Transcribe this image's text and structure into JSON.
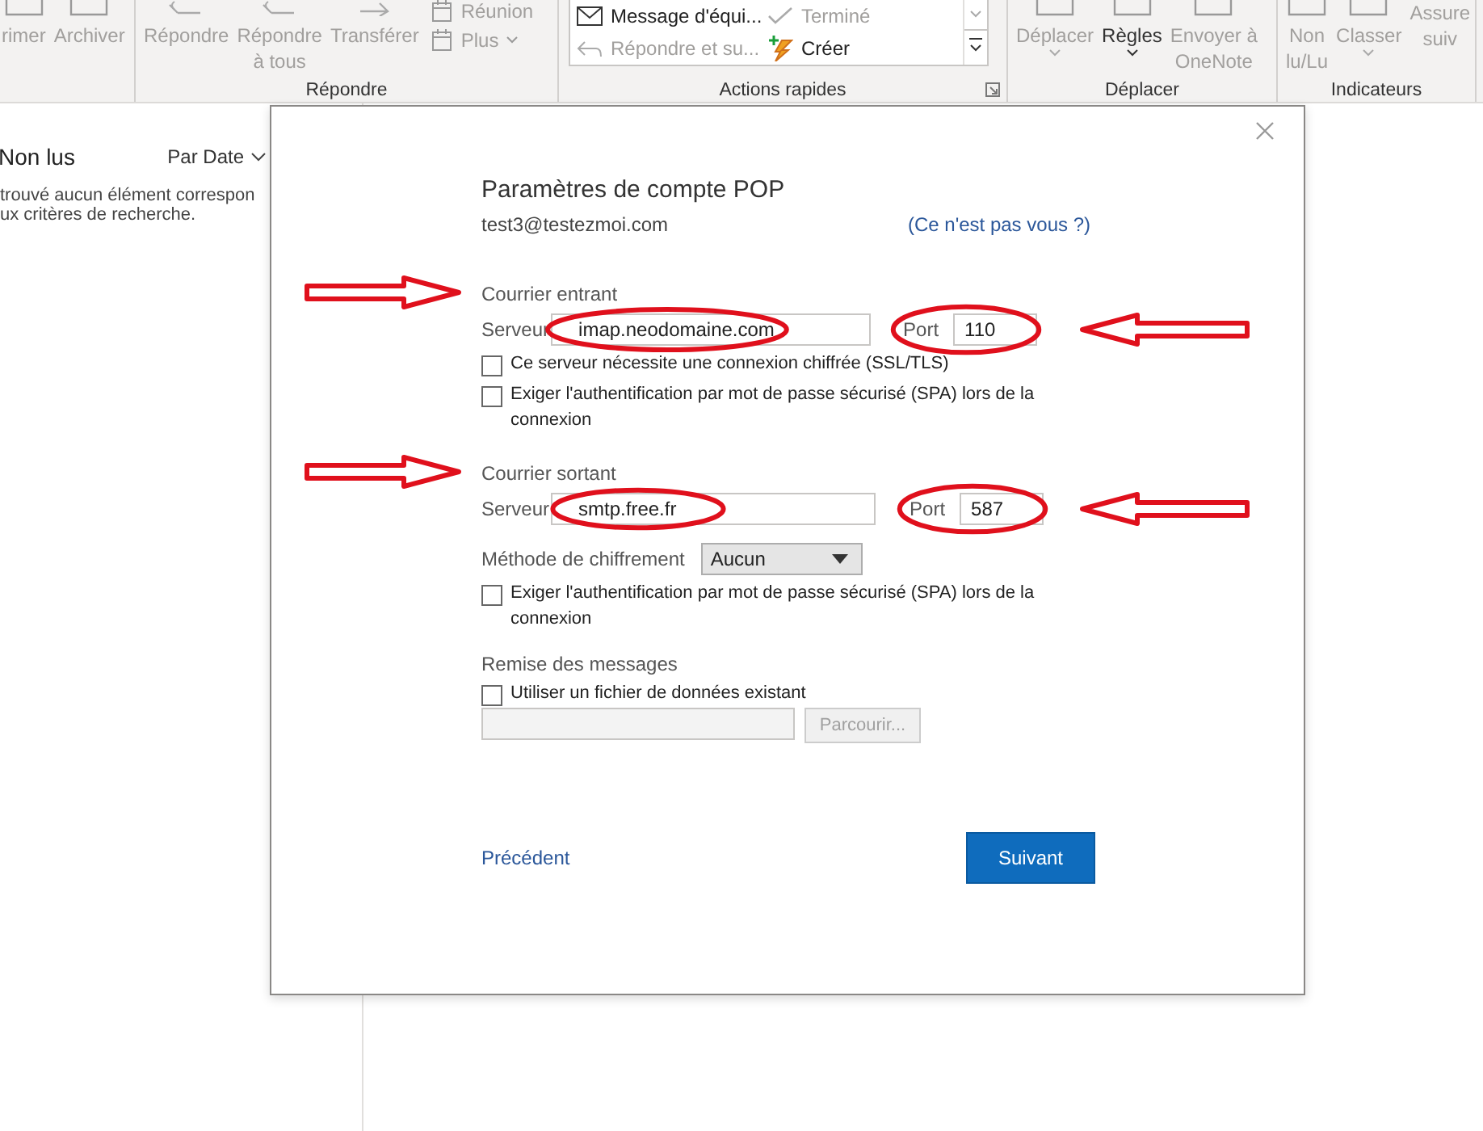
{
  "ribbon": {
    "groups": [
      {
        "commands": [
          {
            "label": "rimer",
            "kind": "trash",
            "disabled": true,
            "dropdown": false
          },
          {
            "label": "Archiver",
            "kind": "box",
            "disabled": true,
            "dropdown": false
          }
        ]
      },
      {
        "label": "Répondre",
        "commands": [
          {
            "label": "Répondre",
            "kind": "reply",
            "disabled": true,
            "dropdown": false
          },
          {
            "label": "Répondre\nà tous",
            "kind": "reply",
            "disabled": true,
            "dropdown": false
          },
          {
            "label": "Transférer",
            "kind": "forward",
            "disabled": true,
            "dropdown": false
          }
        ],
        "small_commands": [
          {
            "label": "Réunion",
            "kind": "calendar",
            "disabled": true,
            "dropdown": false
          },
          {
            "label": "Plus",
            "kind": "calendar",
            "disabled": true,
            "dropdown": true
          }
        ]
      },
      {
        "label": "Actions rapides",
        "quick_steps": [
          {
            "label": "Message d'équi...",
            "kind": "mail",
            "disabled": false
          },
          {
            "label": "Terminé",
            "kind": "check",
            "disabled": true
          },
          {
            "label": "Répondre et su...",
            "kind": "reply",
            "disabled": true
          },
          {
            "label": "Créer",
            "kind": "bolt",
            "disabled": false
          }
        ]
      },
      {
        "label": "Déplacer",
        "commands": [
          {
            "label": "Déplacer",
            "kind": "box",
            "disabled": true,
            "dropdown": true
          },
          {
            "label": "Règles",
            "kind": "box",
            "disabled": false,
            "dropdown": true
          },
          {
            "label": "Envoyer à\nOneNote",
            "kind": "box",
            "disabled": true,
            "dropdown": false
          }
        ]
      },
      {
        "label": "Indicateurs",
        "commands": [
          {
            "label": "Non\nlu/Lu",
            "kind": "box",
            "disabled": true,
            "dropdown": false
          },
          {
            "label": "Classer",
            "kind": "box",
            "disabled": true,
            "dropdown": true
          },
          {
            "label": "Assure\nsuiv",
            "kind": "none",
            "disabled": true,
            "dropdown": false
          }
        ]
      }
    ]
  },
  "message_list": {
    "filter": "Non lus",
    "sort": "Par Date",
    "empty_message": [
      "trouvé aucun élément correspon",
      "ux critères de recherche."
    ]
  },
  "dialog": {
    "title": "Paramètres de compte POP",
    "email": "test3@testezmoi.com",
    "not_you_link": "(Ce n'est pas vous ?)",
    "incoming": {
      "heading": "Courrier entrant",
      "marked": true,
      "server_label": "Serveur",
      "server": "imap.neodomaine.com",
      "server_highlighted": true,
      "port_label": "Port",
      "port": "110",
      "port_highlighted": true,
      "options": [
        {
          "label": "Ce serveur nécessite une connexion chiffrée (SSL/TLS)",
          "checked": false
        },
        {
          "label": "Exiger l'authentification par mot de passe sécurisé (SPA) lors de la connexion",
          "checked": false
        }
      ]
    },
    "outgoing": {
      "heading": "Courrier sortant",
      "marked": true,
      "server_label": "Serveur",
      "server": "smtp.free.fr",
      "server_highlighted": true,
      "port_label": "Port",
      "port": "587",
      "port_highlighted": true,
      "encryption_label": "Méthode de chiffrement",
      "encryption": "Aucun",
      "options": [
        {
          "label": "Exiger l'authentification par mot de passe sécurisé (SPA) lors de la connexion",
          "checked": false
        }
      ]
    },
    "delivery": {
      "heading": "Remise des messages",
      "option": {
        "label": "Utiliser un fichier de données existant",
        "checked": false
      },
      "browse": "Parcourir...",
      "browse_disabled": true
    },
    "back": "Précédent",
    "next": "Suivant"
  }
}
